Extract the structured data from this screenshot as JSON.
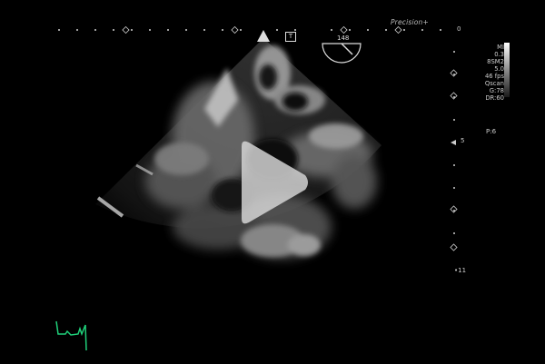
{
  "header": {
    "brand": "Precision+",
    "depth_top": "0",
    "depth_mid": "5",
    "depth_bottom": "11",
    "transducer_marker": "T",
    "angle": "148"
  },
  "parameters": {
    "lines": [
      "MI",
      "0.3",
      "8SM2",
      "5.0",
      "46 fps",
      "Qscan",
      "G:78",
      "DR:60"
    ],
    "p_value": "P:6"
  },
  "player": {
    "play_label": "Play video"
  },
  "colors": {
    "background": "#000000",
    "ecg_trace": "#1fd07a",
    "overlay_text": "#cccccc"
  }
}
